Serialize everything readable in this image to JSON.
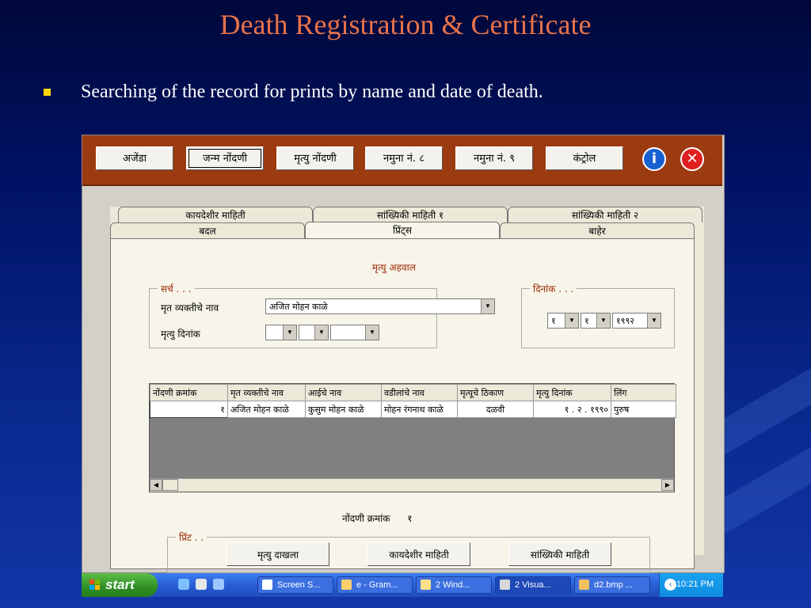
{
  "slide": {
    "title": "Death Registration & Certificate",
    "bullet": "Searching of the record for prints by name and date of death."
  },
  "toolbar": {
    "buttons": [
      "अजेंडा",
      "जन्म नोंदणी",
      "मृत्यु नोंदणी",
      "नमुना नं. ८",
      "नमुना नं. ९",
      "कंट्रोल"
    ],
    "info_glyph": "i",
    "close_glyph": "✕"
  },
  "tabs": {
    "row1": [
      "कायदेशीर माहिती",
      "सांख्यिकी माहिती १",
      "सांख्यिकी माहिती २"
    ],
    "row2": [
      "बदल",
      "प्रिंट्स",
      "बाहेर"
    ],
    "selected": "प्रिंट्स"
  },
  "form": {
    "heading": "मृत्यु अहवाल",
    "search_group": {
      "title": "सर्च . . .",
      "name_label": "मृत व्यक्तीचे नाव",
      "name_value": "अजित मोहन काळे",
      "date_label": "मृत्यु दिनांक"
    },
    "date_group": {
      "title": "दिनांक . . .",
      "day": "१",
      "month": "१",
      "year": "१९९२"
    }
  },
  "grid": {
    "columns": [
      "नोंदणी क्रमांक",
      "मृत व्यक्तीचे नाव",
      "आईचे नाव",
      "वडीलांचे नाव",
      "मृत्यूचे ठिकाण",
      "मृत्यु दिनांक",
      "लिंग"
    ],
    "rows": [
      [
        "१",
        "अजित मोहन काळे",
        "कुसुम मोहन काळे",
        "मोहन रंगनाथ काळे",
        "दळवी",
        "१ . २ . १९९०",
        "पुरुष"
      ]
    ]
  },
  "registration": {
    "label": "नोंदणी क्रमांक",
    "value": "१"
  },
  "print_group": {
    "title": "प्रिंट . .",
    "buttons": [
      "मृत्यु दाखला",
      "कायदेशीर माहिती",
      "सांख्यिकी माहिती"
    ]
  },
  "taskbar": {
    "start": "start",
    "items": [
      "Screen S...",
      "e - Gram...",
      "2 Wind...",
      "2 Visua...",
      "d2.bmp ..."
    ],
    "clock": "10:21 PM"
  }
}
